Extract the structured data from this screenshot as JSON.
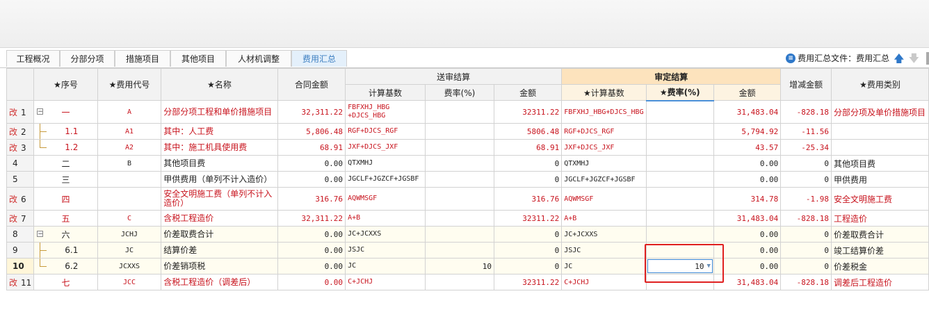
{
  "tabs": [
    {
      "label": "工程概况",
      "active": false
    },
    {
      "label": "分部分项",
      "active": false
    },
    {
      "label": "措施项目",
      "active": false
    },
    {
      "label": "其他项目",
      "active": false
    },
    {
      "label": "人材机调整",
      "active": false
    },
    {
      "label": "费用汇总",
      "active": true
    }
  ],
  "summary_file": {
    "label": "费用汇总文件：费用汇总",
    "icon": "info-icon"
  },
  "table": {
    "headers": {
      "seq": "★序号",
      "code": "★费用代号",
      "name": "★名称",
      "contract": "合同金额",
      "submit_group": "送审结算",
      "approved_group": "审定结算",
      "base": "计算基数",
      "rate": "费率(%)",
      "amount": "金额",
      "approved_base": "★计算基数",
      "approved_rate": "★费率(%)",
      "approved_amount": "金额",
      "diff": "增减金额",
      "category": "★费用类别"
    },
    "rows": [
      {
        "n": "1",
        "mark": "改",
        "seq": "一",
        "code": "A",
        "name": "分部分项工程和单价措施项目",
        "contract": "32,311.22",
        "base": "FBFXHJ_HBG +DJCS_HBG",
        "rate": "",
        "amount": "32311.22",
        "abase": "FBFXHJ_HBG+DJCS_HBG",
        "arate": "",
        "aamount": "31,483.04",
        "diff": "-828.18",
        "cat": "分部分项及单价措施项目",
        "red": true
      },
      {
        "n": "2",
        "mark": "改",
        "seq": "1.1",
        "code": "A1",
        "name": "其中：人工费",
        "contract": "5,806.48",
        "base": "RGF+DJCS_RGF",
        "rate": "",
        "amount": "5806.48",
        "abase": "RGF+DJCS_RGF",
        "arate": "",
        "aamount": "5,794.92",
        "diff": "-11.56",
        "cat": "",
        "red": true
      },
      {
        "n": "3",
        "mark": "改",
        "seq": "1.2",
        "code": "A2",
        "name": "其中：施工机具使用费",
        "contract": "68.91",
        "base": "JXF+DJCS_JXF",
        "rate": "",
        "amount": "68.91",
        "abase": "JXF+DJCS_JXF",
        "arate": "",
        "aamount": "43.57",
        "diff": "-25.34",
        "cat": "",
        "red": true
      },
      {
        "n": "4",
        "mark": "",
        "seq": "二",
        "code": "B",
        "name": "其他项目费",
        "contract": "0.00",
        "base": "QTXMHJ",
        "rate": "",
        "amount": "0",
        "abase": "QTXMHJ",
        "arate": "",
        "aamount": "0.00",
        "diff": "0",
        "cat": "其他项目费",
        "red": false
      },
      {
        "n": "5",
        "mark": "",
        "seq": "三",
        "code": "",
        "name": "甲供费用（单列不计入造价）",
        "contract": "0.00",
        "base": "JGCLF+JGZCF+JGSBF",
        "rate": "",
        "amount": "0",
        "abase": "JGCLF+JGZCF+JGSBF",
        "arate": "",
        "aamount": "0.00",
        "diff": "0",
        "cat": "甲供费用",
        "red": false
      },
      {
        "n": "6",
        "mark": "改",
        "seq": "四",
        "code": "",
        "name": "安全文明施工费（单列不计入造价）",
        "contract": "316.76",
        "base": "AQWMSGF",
        "rate": "",
        "amount": "316.76",
        "abase": "AQWMSGF",
        "arate": "",
        "aamount": "314.78",
        "diff": "-1.98",
        "cat": "安全文明施工费",
        "red": true
      },
      {
        "n": "7",
        "mark": "改",
        "seq": "五",
        "code": "C",
        "name": "含税工程造价",
        "contract": "32,311.22",
        "base": "A+B",
        "rate": "",
        "amount": "32311.22",
        "abase": "A+B",
        "arate": "",
        "aamount": "31,483.04",
        "diff": "-828.18",
        "cat": "工程造价",
        "red": true
      },
      {
        "n": "8",
        "mark": "",
        "seq": "六",
        "code": "JCHJ",
        "name": "价差取费合计",
        "contract": "0.00",
        "base": "JC+JCXXS",
        "rate": "",
        "amount": "0",
        "abase": "JC+JCXXS",
        "arate": "",
        "aamount": "0.00",
        "diff": "0",
        "cat": "价差取费合计",
        "red": false
      },
      {
        "n": "9",
        "mark": "",
        "seq": "6.1",
        "code": "JC",
        "name": "结算价差",
        "contract": "0.00",
        "base": "JSJC",
        "rate": "",
        "amount": "0",
        "abase": "JSJC",
        "arate": "",
        "aamount": "0.00",
        "diff": "0",
        "cat": "竣工结算价差",
        "red": false
      },
      {
        "n": "10",
        "mark": "",
        "seq": "6.2",
        "code": "JCXXS",
        "name": "价差销项税",
        "contract": "0.00",
        "base": "JC",
        "rate": "10",
        "amount": "0",
        "abase": "JC",
        "arate": "10",
        "aamount": "0.00",
        "diff": "0",
        "cat": "价差税金",
        "red": false
      },
      {
        "n": "11",
        "mark": "改",
        "seq": "七",
        "code": "JCC",
        "name": "含税工程造价（调差后）",
        "contract": "0.00",
        "base": "C+JCHJ",
        "rate": "",
        "amount": "32311.22",
        "abase": "C+JCHJ",
        "arate": "",
        "aamount": "31,483.04",
        "diff": "-828.18",
        "cat": "调差后工程造价",
        "red": true
      }
    ]
  }
}
